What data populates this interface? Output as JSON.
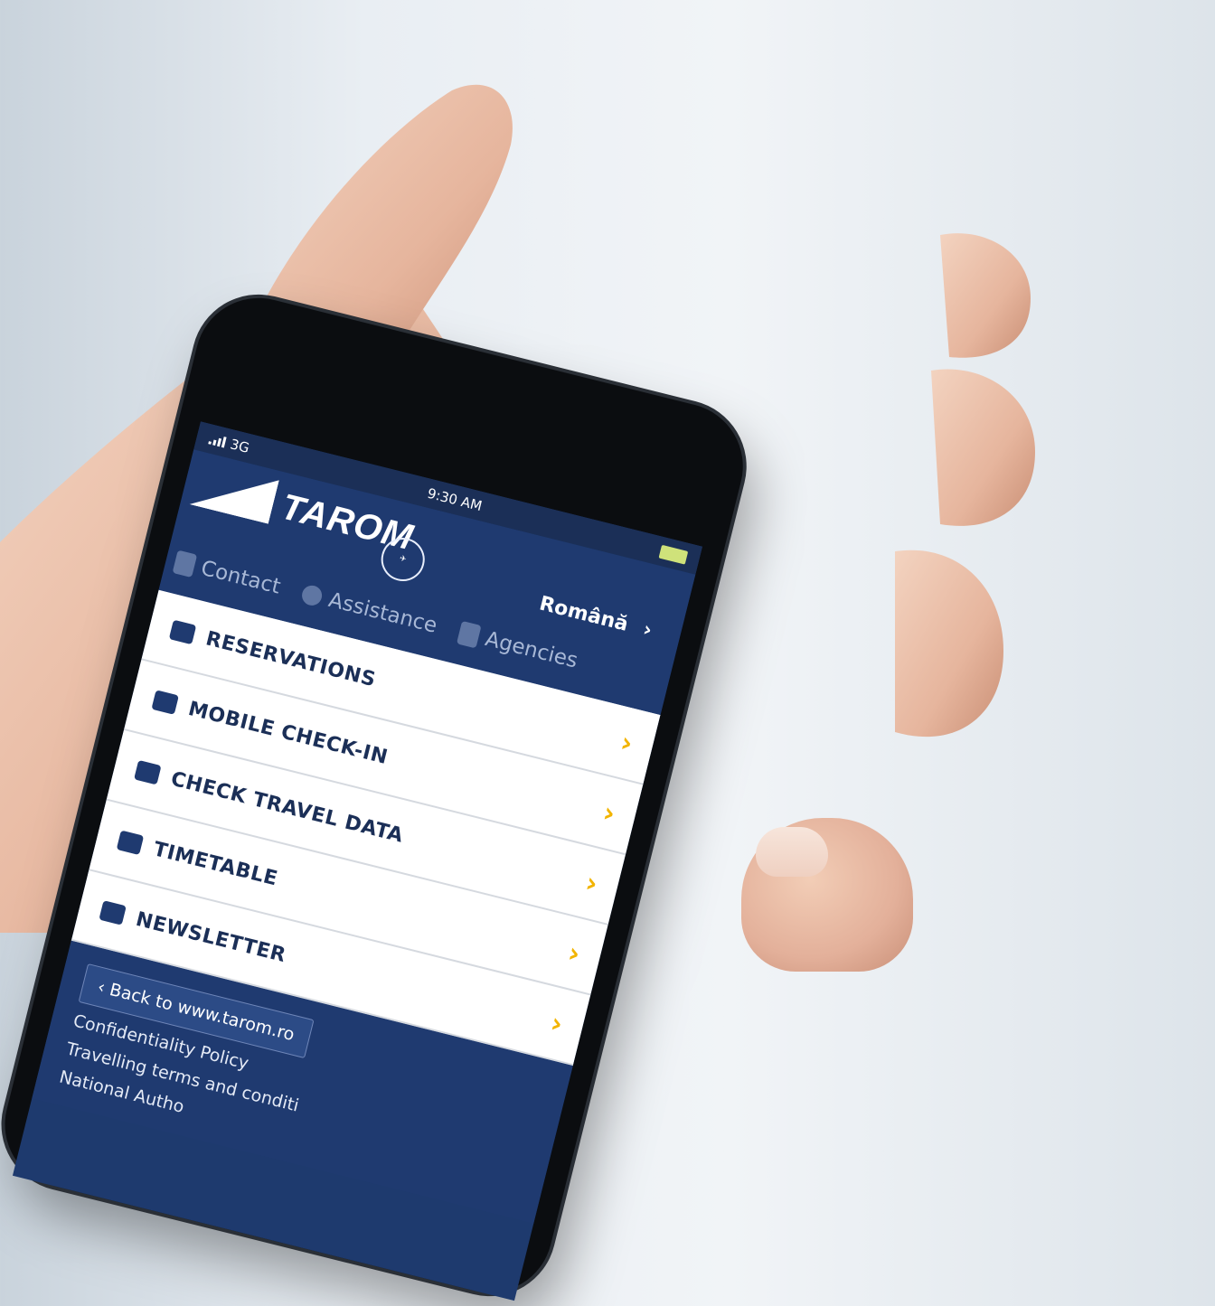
{
  "statusbar": {
    "network": "3G",
    "time": "9:30 AM"
  },
  "header": {
    "logo_text": "TAROM",
    "language": "Română",
    "language_chevron": "›",
    "nav": [
      {
        "label": "Contact"
      },
      {
        "label": "Assistance"
      },
      {
        "label": "Agencies"
      }
    ]
  },
  "menu": {
    "items": [
      {
        "label": "RESERVATIONS",
        "icon": "reservations-icon"
      },
      {
        "label": "MOBILE CHECK-IN",
        "icon": "briefcase-icon"
      },
      {
        "label": "CHECK TRAVEL DATA",
        "icon": "globe-icon"
      },
      {
        "label": "TIMETABLE",
        "icon": "calendar-icon"
      },
      {
        "label": "NEWSLETTER",
        "icon": "envelope-icon"
      }
    ],
    "chevron": "›"
  },
  "footer": {
    "back_label": "‹ Back to www.tarom.ro",
    "links": [
      "Confidentiality Policy",
      "Travelling terms and conditi",
      "National Autho"
    ]
  },
  "colors": {
    "navy": "#1f3a70",
    "accent": "#f2b400",
    "skin": "#e3b09a"
  }
}
